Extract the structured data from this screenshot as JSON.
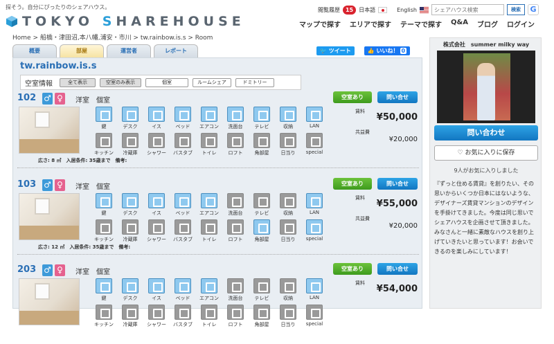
{
  "header": {
    "tagline": "探そう。自分にぴったりのシェアハウス。",
    "logo": {
      "part1": "TOKYO ",
      "accent": "S",
      "part2": "HAREHOUSE"
    },
    "history_label": "閲覧履歴",
    "history_count": "15",
    "lang_ja": "日本語",
    "lang_en": "English",
    "search_placeholder": "シェアハウス検索",
    "search_button": "検索",
    "google_label": "G",
    "nav": [
      "マップで探す",
      "エリアで探す",
      "テーマで探す",
      "Q&A",
      "ブログ",
      "ログイン"
    ]
  },
  "breadcrumb": "Home > 船橋・津田沼,本八幡,浦安・市川 > tw.rainbow.is.s > Room",
  "tabs": [
    "概要",
    "部屋",
    "運営者",
    "レポート"
  ],
  "social": {
    "tweet": "ツイート",
    "like": "いいね！",
    "like_count": "0"
  },
  "property_name": "tw.rainbow.is.s",
  "filter": {
    "title": "空室情報",
    "buttons": [
      "全て表示",
      "空室のみ表示",
      "個室",
      "ルームシェア",
      "ドミトリー"
    ]
  },
  "amenity_labels": [
    "鍵",
    "デスク",
    "イス",
    "ベッド",
    "エアコン",
    "洗面台",
    "テレビ",
    "収納",
    "LAN",
    "キッチン",
    "冷蔵庫",
    "シャワー",
    "バスタブ",
    "トイレ",
    "ロフト",
    "角部屋",
    "日当り",
    "special"
  ],
  "rooms": [
    {
      "number": "102",
      "type": "洋室　個室",
      "status": "空室あり",
      "inquiry": "問い合せ",
      "rent_label": "賃料",
      "rent": "¥50,000",
      "fee_label": "共益費",
      "fee": "¥20,000",
      "conditions": "広さ: 8 ㎡　入居条件: 35歳まで　備考:",
      "available": [
        true,
        true,
        true,
        true,
        true,
        true,
        true,
        true,
        true,
        false,
        false,
        false,
        false,
        false,
        false,
        false,
        false,
        false
      ]
    },
    {
      "number": "103",
      "type": "洋室　個室",
      "status": "空室あり",
      "inquiry": "問い合せ",
      "rent_label": "賃料",
      "rent": "¥55,000",
      "fee_label": "共益費",
      "fee": "¥20,000",
      "conditions": "広さ: 12 ㎡　入居条件: 35歳まで　備考:",
      "available": [
        true,
        true,
        true,
        true,
        true,
        false,
        false,
        false,
        true,
        false,
        false,
        false,
        false,
        false,
        false,
        true,
        false,
        true
      ]
    },
    {
      "number": "203",
      "type": "洋室　個室",
      "status": "空室あり",
      "inquiry": "問い合せ",
      "rent_label": "賃料",
      "rent": "¥54,000",
      "fee_label": "",
      "fee": "",
      "conditions": "",
      "available": [
        true,
        true,
        true,
        true,
        true,
        false,
        false,
        false,
        true,
        false,
        false,
        false,
        false,
        false,
        false,
        false,
        false,
        false
      ]
    }
  ],
  "sidebar": {
    "company": "株式会社　summer milky way",
    "inquiry": "問い合わせ",
    "favorite": "お気に入りに保存",
    "fav_count": "9人がお気に入りしました",
    "description": "『ずっと住める賃貸』を創りたい、その思いからいくつか日本にはないような、デザイナーズ賃貸マンションのデザインを手掛けてきました。今度は同じ思いでシェアハウスを企画させて頂きました。みなさんと一緒に素敵なハウスを創り上げていきたいと思っています！お会いできるのを楽しみにしています！"
  }
}
